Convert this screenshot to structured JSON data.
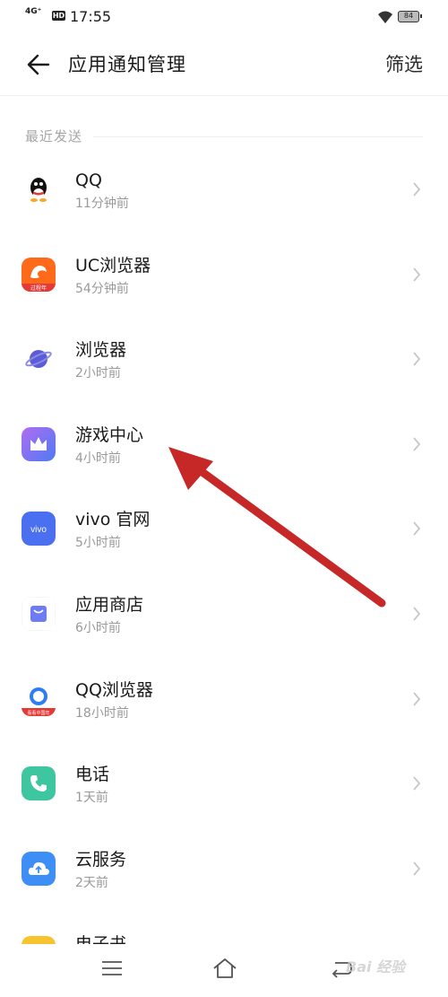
{
  "status_bar": {
    "network": "4G⁺",
    "hd_badge": "HD",
    "time": "17:55",
    "battery": "84"
  },
  "header": {
    "title": "应用通知管理",
    "filter_label": "筛选"
  },
  "section": {
    "label": "最近发送"
  },
  "apps": [
    {
      "name": "QQ",
      "time": "11分钟前",
      "icon": "qq-penguin-icon"
    },
    {
      "name": "UC浏览器",
      "time": "54分钟前",
      "icon": "uc-browser-icon",
      "icon_badge": "过程年"
    },
    {
      "name": "浏览器",
      "time": "2小时前",
      "icon": "planet-browser-icon"
    },
    {
      "name": "游戏中心",
      "time": "4小时前",
      "icon": "crown-icon"
    },
    {
      "name": "vivo 官网",
      "time": "5小时前",
      "icon": "vivo-logo-icon",
      "icon_text": "vivo"
    },
    {
      "name": "应用商店",
      "time": "6小时前",
      "icon": "shopping-bag-icon"
    },
    {
      "name": "QQ浏览器",
      "time": "18小时前",
      "icon": "qq-browser-icon",
      "icon_badge": "看看中国年"
    },
    {
      "name": "电话",
      "time": "1天前",
      "icon": "phone-icon"
    },
    {
      "name": "云服务",
      "time": "2天前",
      "icon": "cloud-upload-icon"
    },
    {
      "name": "电子书",
      "time": "",
      "icon": "ebook-icon"
    }
  ],
  "watermark": "Bai 经验",
  "colors": {
    "annotation_arrow": "#c62828",
    "secondary_text": "#9a9a9a"
  }
}
